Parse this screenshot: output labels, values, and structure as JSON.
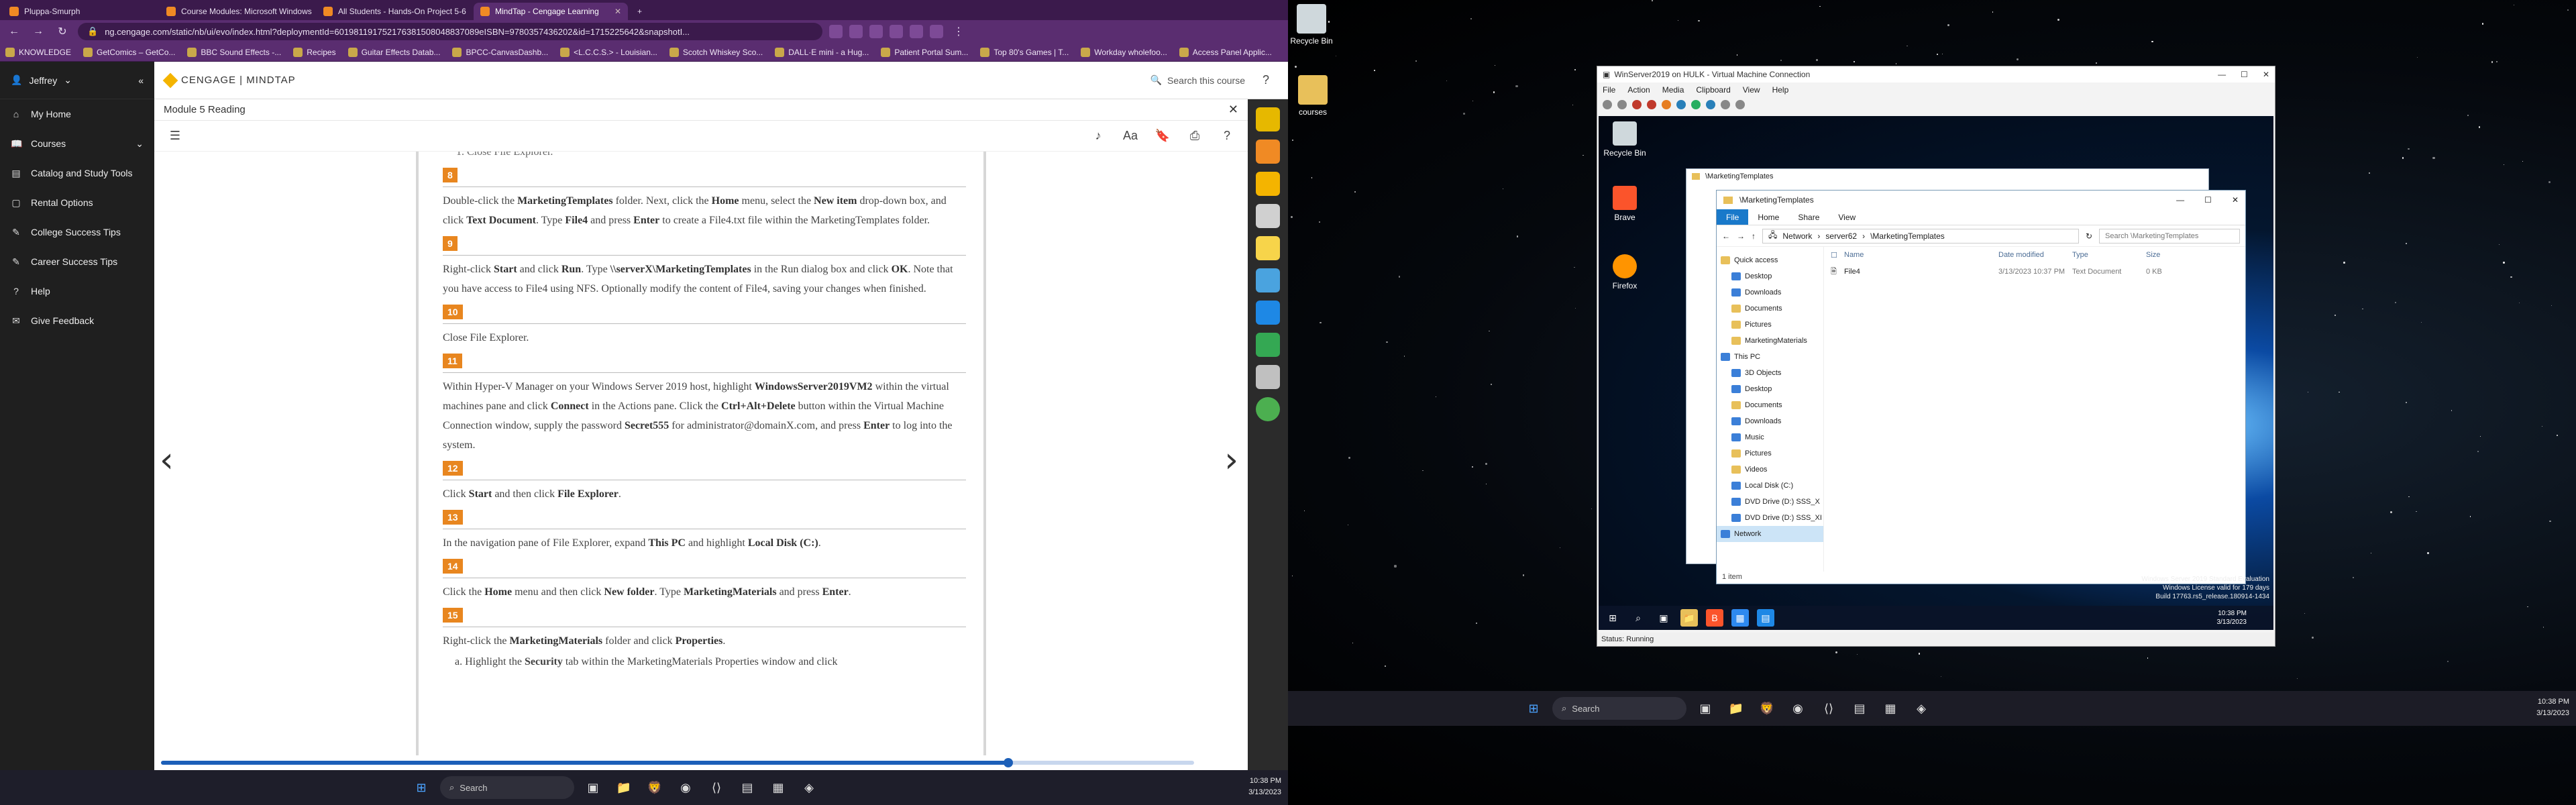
{
  "browser": {
    "tabs": [
      {
        "label": "Pluppa-Smurph"
      },
      {
        "label": "Course Modules: Microsoft Windows"
      },
      {
        "label": "All Students - Hands-On Project 5-6"
      },
      {
        "label": "MindTap - Cengage Learning"
      }
    ],
    "url": "ng.cengage.com/static/nb/ui/evo/index.html?deploymentId=601981191752176381508048837089eISBN=9780357436202&id=1715225642&snapshotI...",
    "bookmarks": [
      "KNOWLEDGE",
      "GetComics – GetCo...",
      "BBC Sound Effects -...",
      "Recipes",
      "Guitar Effects Datab...",
      "BPCC-CanvasDashb...",
      "<L.C.C.S.> - Louisian...",
      "Scotch Whiskey Sco...",
      "DALL·E mini - a Hug...",
      "Patient Portal Sum...",
      "Top 80's Games | T...",
      "Workday wholefoo...",
      "Access Panel Applic..."
    ]
  },
  "sidebar": {
    "user": "Jeffrey",
    "items": [
      {
        "label": "My Home",
        "icon": "home-icon"
      },
      {
        "label": "Courses",
        "icon": "book-icon"
      },
      {
        "label": "Catalog and Study Tools",
        "icon": "catalog-icon"
      },
      {
        "label": "Rental Options",
        "icon": "rental-icon"
      },
      {
        "label": "College Success Tips",
        "icon": "tips-icon"
      },
      {
        "label": "Career Success Tips",
        "icon": "career-icon"
      },
      {
        "label": "Help",
        "icon": "help-icon"
      },
      {
        "label": "Give Feedback",
        "icon": "feedback-icon"
      }
    ]
  },
  "topstrip": {
    "brand": "CENGAGE | MINDTAP",
    "search_label": "Search this course"
  },
  "reader": {
    "title": "Module 5 Reading",
    "top_fragment": "Close File Explorer.",
    "steps": [
      {
        "num": "8",
        "html": "Double-click the <b>MarketingTemplates</b> folder. Next, click the <b>Home</b> menu, select the <b>New item</b> drop-down box, and click <b>Text Document</b>. Type <b>File4</b> and press <b>Enter</b> to create a File4.txt file within the MarketingTemplates folder."
      },
      {
        "num": "9",
        "html": "Right-click <b>Start</b> and click <b>Run</b>. Type <b>\\\\serverX\\MarketingTemplates</b> in the Run dialog box and click <b>OK</b>. Note that you have access to File4 using NFS. Optionally modify the content of File4, saving your changes when finished."
      },
      {
        "num": "10",
        "html": "Close File Explorer."
      },
      {
        "num": "11",
        "html": "Within Hyper-V Manager on your Windows Server 2019 host, highlight <b>WindowsServer2019VM2</b> within the virtual machines pane and click <b>Connect</b> in the Actions pane. Click the <b>Ctrl+Alt+Delete</b> button within the Virtual Machine Connection window, supply the password <b>Secret555</b> for administrator@domainX.com, and press <b>Enter</b> to log into the system."
      },
      {
        "num": "12",
        "html": "Click <b>Start</b> and then click <b>File Explorer</b>."
      },
      {
        "num": "13",
        "html": "In the navigation pane of File Explorer, expand <b>This PC</b> and highlight <b>Local Disk (C:)</b>."
      },
      {
        "num": "14",
        "html": "Click the <b>Home</b> menu and then click <b>New folder</b>. Type <b>MarketingMaterials</b> and press <b>Enter</b>."
      },
      {
        "num": "15",
        "html": "Right-click the <b>MarketingMaterials</b> folder and click <b>Properties</b>."
      }
    ],
    "substep": "a. Highlight the <b>Security</b> tab within the MarketingMaterials Properties window and click",
    "progress": 0.82
  },
  "taskbar_left": {
    "search_label": "Search",
    "time": "10:38 PM",
    "date": "3/13/2023"
  },
  "desktop": {
    "icons": [
      {
        "label": "Recycle Bin"
      },
      {
        "label": "courses"
      }
    ]
  },
  "vm": {
    "title": "WinServer2019 on HULK - Virtual Machine Connection",
    "menu": [
      "File",
      "Action",
      "Media",
      "Clipboard",
      "View",
      "Help"
    ],
    "desktop_icons": [
      {
        "label": "Recycle Bin"
      },
      {
        "label": "Brave"
      },
      {
        "label": "Firefox"
      }
    ],
    "back_window_title": "\\MarketingTemplates",
    "explorer": {
      "title": "\\MarketingTemplates",
      "ribbon": [
        "File",
        "Home",
        "Share",
        "View"
      ],
      "breadcrumb": [
        "Network",
        "server62",
        "\\MarketingTemplates"
      ],
      "search_placeholder": "Search \\MarketingTemplates",
      "nav": [
        {
          "label": "Quick access",
          "kind": "star"
        },
        {
          "label": "Desktop",
          "kind": "blue"
        },
        {
          "label": "Downloads",
          "kind": "blue"
        },
        {
          "label": "Documents",
          "kind": "folder"
        },
        {
          "label": "Pictures",
          "kind": "folder"
        },
        {
          "label": "MarketingMaterials",
          "kind": "folder"
        },
        {
          "label": "This PC",
          "kind": "blue"
        },
        {
          "label": "3D Objects",
          "kind": "blue"
        },
        {
          "label": "Desktop",
          "kind": "blue"
        },
        {
          "label": "Documents",
          "kind": "folder"
        },
        {
          "label": "Downloads",
          "kind": "blue"
        },
        {
          "label": "Music",
          "kind": "blue"
        },
        {
          "label": "Pictures",
          "kind": "folder"
        },
        {
          "label": "Videos",
          "kind": "folder"
        },
        {
          "label": "Local Disk (C:)",
          "kind": "blue"
        },
        {
          "label": "DVD Drive (D:) SSS_X",
          "kind": "blue"
        },
        {
          "label": "DVD Drive (D:) SSS_XI",
          "kind": "blue"
        },
        {
          "label": "Network",
          "kind": "blue",
          "selected": true
        }
      ],
      "columns": [
        "Name",
        "Date modified",
        "Type",
        "Size"
      ],
      "files": [
        {
          "name": "File4",
          "date": "3/13/2023 10:37 PM",
          "type": "Text Document",
          "size": "0 KB"
        }
      ],
      "status": "1 item"
    },
    "watermark": [
      "Windows Server 2019 Standard Evaluation",
      "Windows License valid for 179 days",
      "Build 17763.rs5_release.180914-1434"
    ],
    "vm_time": "10:38 PM",
    "vm_date": "3/13/2023",
    "status": "Status: Running"
  },
  "taskbar_right": {
    "search_label": "Search",
    "time": "10:38 PM",
    "date": "3/13/2023"
  }
}
